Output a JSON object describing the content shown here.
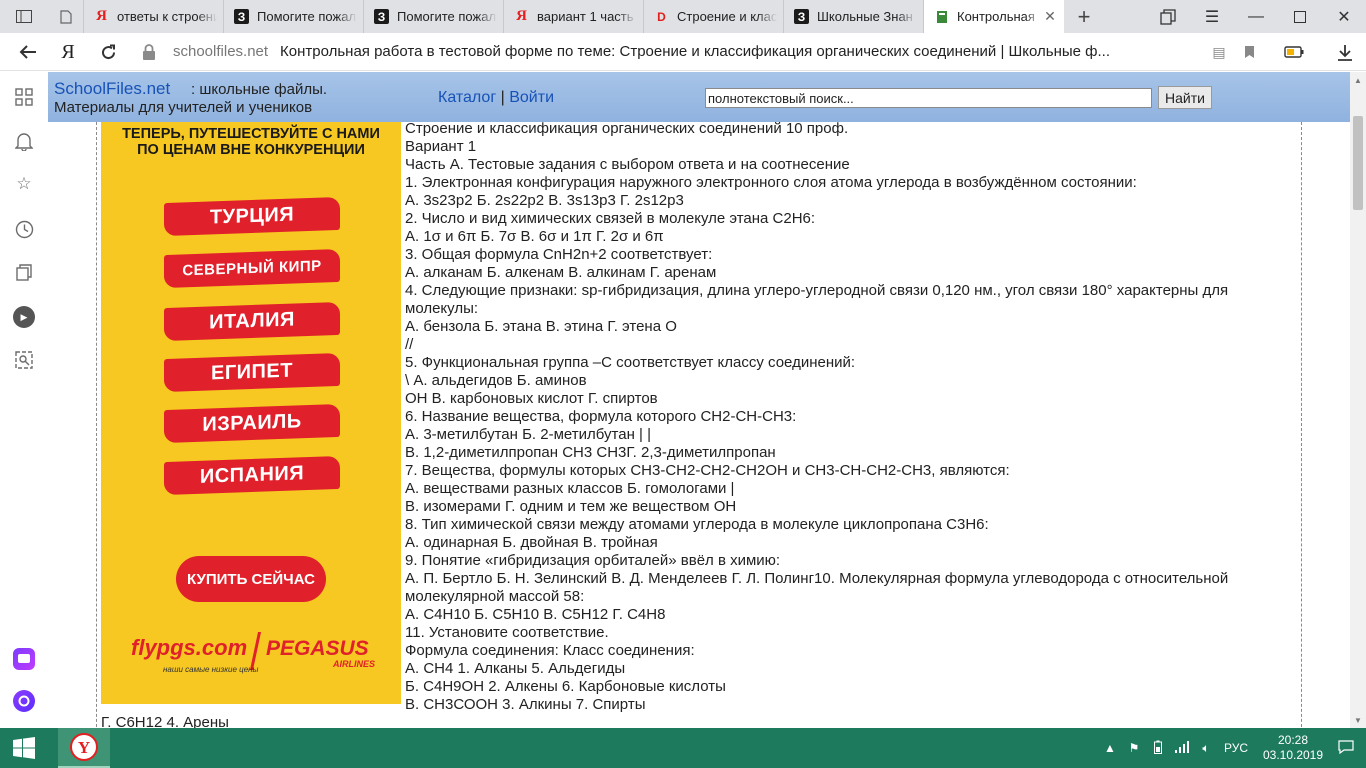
{
  "browser": {
    "tabs": [
      {
        "title": "ответы к строени",
        "favicon": "yandex-icon"
      },
      {
        "title": "Помогите пожал",
        "favicon": "znanija-icon"
      },
      {
        "title": "Помогите пожал",
        "favicon": "znanija-icon"
      },
      {
        "title": "вариант 1 часть",
        "favicon": "yandex-icon"
      },
      {
        "title": "Строение и клас",
        "favicon": "red-d-icon"
      },
      {
        "title": "Школьные Знан",
        "favicon": "znanija-icon"
      },
      {
        "title": "Контрольная",
        "favicon": "green-book-icon",
        "active": true
      }
    ],
    "address": {
      "domain": "schoolfiles.net",
      "title": "Контрольная работа в тестовой форме по теме: Строение и классификация органических соединений | Школьные ф..."
    }
  },
  "site": {
    "brand": "SchoolFiles.net",
    "tagline": ": школьные файлы.",
    "subtitle": "Материалы для учителей и учеников",
    "nav": {
      "catalog": "Каталог",
      "sep": "|",
      "login": "Войти"
    },
    "search": {
      "value": "полнотекстовый поиск...",
      "button": "Найти"
    }
  },
  "ad": {
    "headline_1": "ТЕПЕРЬ, ПУТЕШЕСТВУЙТЕ С НАМИ",
    "headline_2": "ПО ЦЕНАМ ВНЕ КОНКУРЕНЦИИ",
    "destinations": [
      "ТУРЦИЯ",
      "СЕВЕРНЫЙ КИПР",
      "ИТАЛИЯ",
      "ЕГИПЕТ",
      "ИЗРАИЛЬ",
      "ИСПАНИЯ"
    ],
    "cta": "КУПИТЬ СЕЙЧАС",
    "logo_domain": "flypgs.com",
    "logo_brand": "PEGASUS",
    "logo_brand_sub": "AIRLINES",
    "logo_tagline": "наши самые низкие цены",
    "color": "#f7c821",
    "accent": "#e0202b"
  },
  "article": {
    "lines": [
      "Строение и классификация органических соединений 10 проф.",
      "Вариант 1",
      "Часть А. Тестовые задания с выбором ответа и на соотнесение",
      "1. Электронная конфигурация наружного электронного слоя атома углерода в возбуждённом состоянии:",
      "А. 3s23p2 Б. 2s22p2 В. 3s13p3 Г. 2s12p3",
      "2. Число и вид химических связей в молекуле этана C2H6:",
      "А. 1σ и 6π Б. 7σ В. 6σ и 1π Г. 2σ и 6π",
      "3. Общая формула CnH2n+2 соответствует:",
      "А. алканам Б. алкенам В. алкинам Г. аренам",
      "4. Следующие признаки: sp-гибридизация, длина углеро-углеродной связи 0,120 нм., угол связи 180° характерны для молекулы:",
      "А. бензола Б. этана В. этина Г. этена О",
      "//",
      "5. Функциональная группа –С соответствует классу соединений:",
      "\\ А. альдегидов Б. аминов",
      "ОН В. карбоновых кислот Г. спиртов",
      "6. Название вещества, формула которого СН2-СН-СН3:",
      "А. 3-метилбутан Б. 2-метилбутан | |",
      "В. 1,2-диметилпропан СН3 СН3Г. 2,3-диметилпропан",
      "7. Вещества, формулы которых СН3-СН2-СН2-СН2ОН и СН3-СН-СН2-СН3, являются:",
      "А. веществами разных классов Б. гомологами |",
      "В. изомерами Г. одним и тем же веществом ОН",
      "8. Тип химической связи между атомами углерода в молекуле циклопропана С3Н6:",
      "А. одинарная Б. двойная В. тройная",
      "9. Понятие «гибридизация орбиталей» ввёл в химию:",
      "А. П. Бертло Б. Н. Зелинский В. Д. Менделеев Г. Л. Полинг10. Молекулярная формула углеводорода с относительной молекулярной массой 58:",
      "А. С4Н10 Б. С5Н10 В. С5Н12 Г. С4Н8",
      "11. Установите соответствие.",
      "Формула соединения: Класс соединения:",
      "А. СН4 1. Алканы 5. Альдегиды",
      "Б. С4Н9ОН 2. Алкены 6. Карбоновые кислоты",
      "В. СН3СООН 3. Алкины 7. Спирты"
    ],
    "tail": "Г. С6Н12 4. Арены"
  },
  "taskbar": {
    "lang": "РУС",
    "time": "20:28",
    "date": "03.10.2019",
    "color": "#1e7a5d"
  }
}
